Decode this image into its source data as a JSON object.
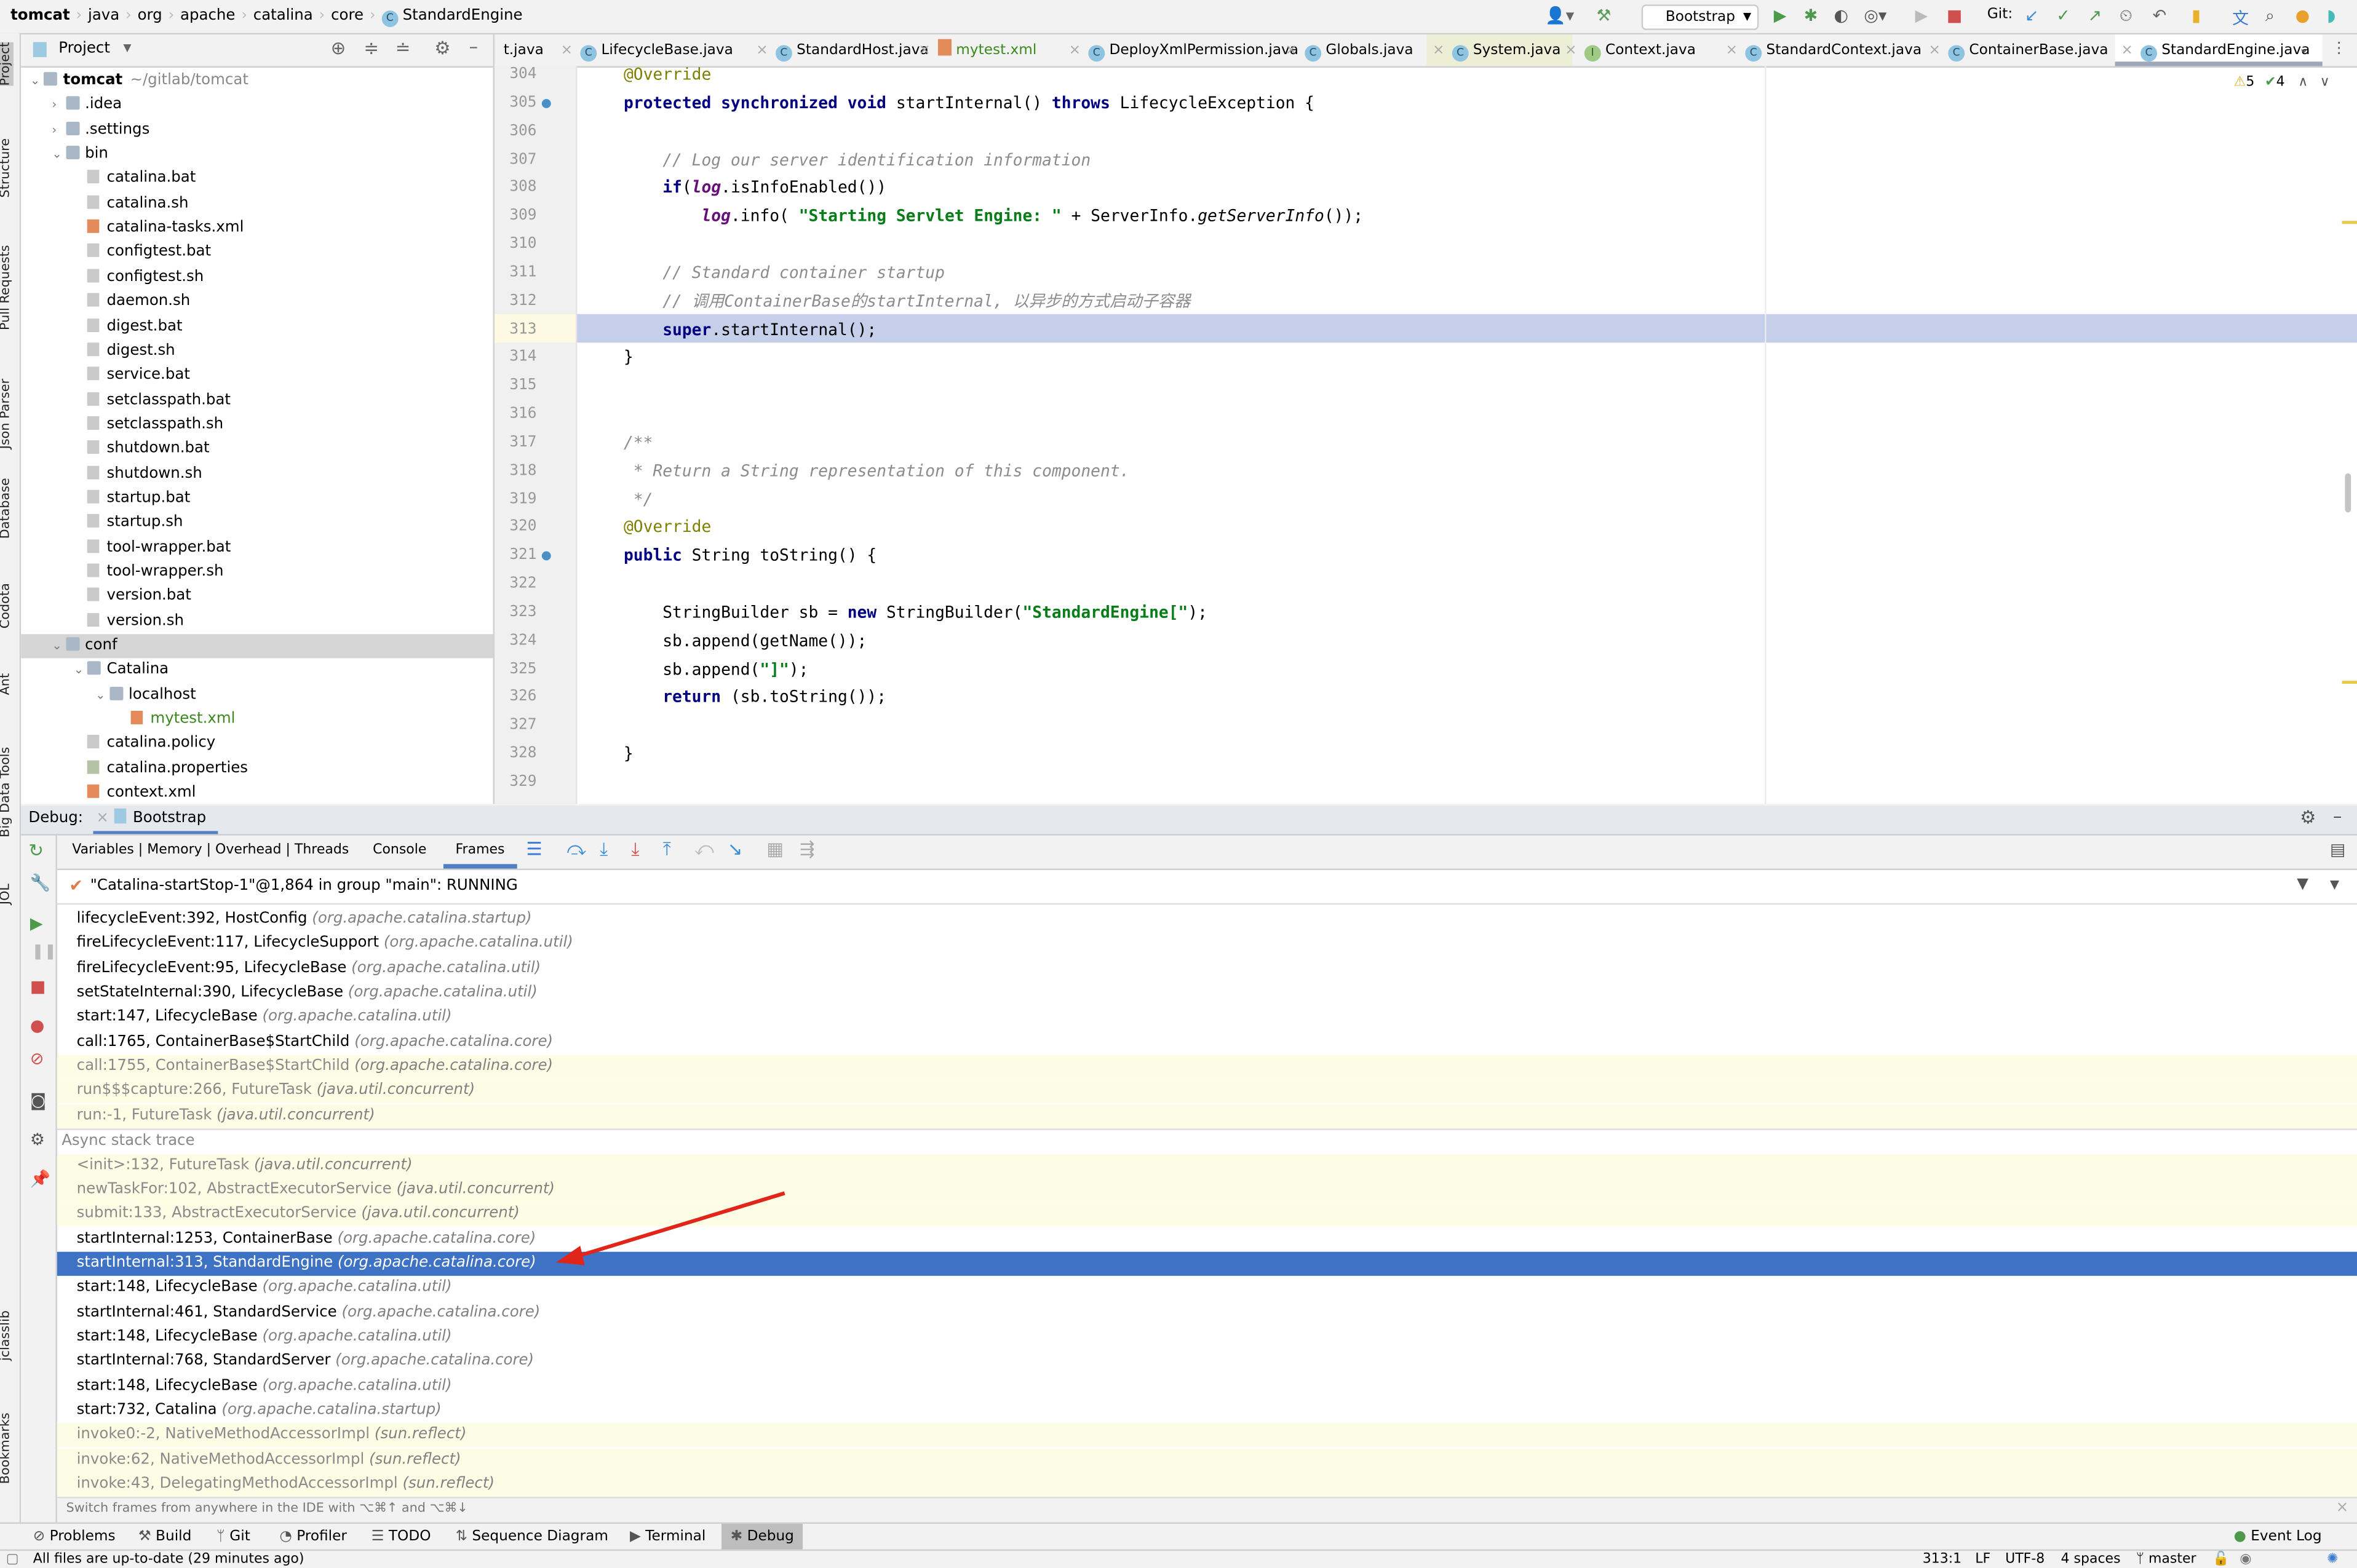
{
  "breadcrumb": [
    "tomcat",
    "java",
    "org",
    "apache",
    "catalina",
    "core",
    "StandardEngine"
  ],
  "toolbar": {
    "run_config": "Bootstrap",
    "git_label": "Git:"
  },
  "left_stripe": [
    "Project",
    "Structure",
    "Pull Requests",
    "Json Parser",
    "Database",
    "Codota",
    "Ant",
    "Big Data Tools",
    "JOL",
    "jclasslib",
    "Bookmarks"
  ],
  "project": {
    "title": "Project",
    "tree": [
      {
        "label": "tomcat",
        "suffix": "~/gitlab/tomcat",
        "depth": 0,
        "type": "folder",
        "open": true,
        "bold": true
      },
      {
        "label": ".idea",
        "depth": 1,
        "type": "folder",
        "open": false
      },
      {
        "label": ".settings",
        "depth": 1,
        "type": "folder",
        "open": false
      },
      {
        "label": "bin",
        "depth": 1,
        "type": "folder",
        "open": true
      },
      {
        "label": "catalina.bat",
        "depth": 2,
        "type": "file"
      },
      {
        "label": "catalina.sh",
        "depth": 2,
        "type": "file"
      },
      {
        "label": "catalina-tasks.xml",
        "depth": 2,
        "type": "xml"
      },
      {
        "label": "configtest.bat",
        "depth": 2,
        "type": "file"
      },
      {
        "label": "configtest.sh",
        "depth": 2,
        "type": "file"
      },
      {
        "label": "daemon.sh",
        "depth": 2,
        "type": "file"
      },
      {
        "label": "digest.bat",
        "depth": 2,
        "type": "file"
      },
      {
        "label": "digest.sh",
        "depth": 2,
        "type": "file"
      },
      {
        "label": "service.bat",
        "depth": 2,
        "type": "file"
      },
      {
        "label": "setclasspath.bat",
        "depth": 2,
        "type": "file"
      },
      {
        "label": "setclasspath.sh",
        "depth": 2,
        "type": "file"
      },
      {
        "label": "shutdown.bat",
        "depth": 2,
        "type": "file"
      },
      {
        "label": "shutdown.sh",
        "depth": 2,
        "type": "file"
      },
      {
        "label": "startup.bat",
        "depth": 2,
        "type": "file"
      },
      {
        "label": "startup.sh",
        "depth": 2,
        "type": "file"
      },
      {
        "label": "tool-wrapper.bat",
        "depth": 2,
        "type": "file"
      },
      {
        "label": "tool-wrapper.sh",
        "depth": 2,
        "type": "file"
      },
      {
        "label": "version.bat",
        "depth": 2,
        "type": "file"
      },
      {
        "label": "version.sh",
        "depth": 2,
        "type": "file"
      },
      {
        "label": "conf",
        "depth": 1,
        "type": "folder",
        "open": true,
        "selected": true
      },
      {
        "label": "Catalina",
        "depth": 2,
        "type": "folder",
        "open": true
      },
      {
        "label": "localhost",
        "depth": 3,
        "type": "folder",
        "open": true
      },
      {
        "label": "mytest.xml",
        "depth": 4,
        "type": "xml",
        "green": true
      },
      {
        "label": "catalina.policy",
        "depth": 2,
        "type": "file"
      },
      {
        "label": "catalina.properties",
        "depth": 2,
        "type": "prop"
      },
      {
        "label": "context.xml",
        "depth": 2,
        "type": "xml"
      }
    ]
  },
  "tabs": [
    {
      "label": "t.java",
      "icon": "none"
    },
    {
      "label": "LifecycleBase.java",
      "icon": "c"
    },
    {
      "label": "StandardHost.java",
      "icon": "c"
    },
    {
      "label": "mytest.xml",
      "icon": "xml",
      "green": true
    },
    {
      "label": "DeployXmlPermission.java",
      "icon": "c"
    },
    {
      "label": "Globals.java",
      "icon": "c"
    },
    {
      "label": "System.java",
      "icon": "c",
      "pinned": true
    },
    {
      "label": "Context.java",
      "icon": "i"
    },
    {
      "label": "StandardContext.java",
      "icon": "c"
    },
    {
      "label": "ContainerBase.java",
      "icon": "c"
    },
    {
      "label": "StandardEngine.java",
      "icon": "c",
      "selected": true
    }
  ],
  "inspections": {
    "warnings": "5",
    "ok": "4"
  },
  "code": [
    {
      "n": "304",
      "toks": [
        [
          "    ",
          ""
        ],
        [
          "@Override",
          "ann"
        ]
      ]
    },
    {
      "n": "305",
      "toks": [
        [
          "    ",
          ""
        ],
        [
          "protected synchronized void ",
          "kw"
        ],
        [
          "startInternal() ",
          ""
        ],
        [
          "throws ",
          "kw"
        ],
        [
          "LifecycleException {",
          ""
        ]
      ]
    },
    {
      "n": "306",
      "toks": []
    },
    {
      "n": "307",
      "toks": [
        [
          "        ",
          ""
        ],
        [
          "// Log our server identification information",
          "cmt"
        ]
      ]
    },
    {
      "n": "308",
      "toks": [
        [
          "        ",
          ""
        ],
        [
          "if",
          "kw"
        ],
        [
          "(",
          ""
        ],
        [
          "log",
          "fld"
        ],
        [
          ".isInfoEnabled())",
          ""
        ]
      ]
    },
    {
      "n": "309",
      "toks": [
        [
          "            ",
          ""
        ],
        [
          "log",
          "fld"
        ],
        [
          ".info( ",
          ""
        ],
        [
          "\"Starting Servlet Engine: \"",
          "str"
        ],
        [
          " + ServerInfo.",
          ""
        ],
        [
          "getServerInfo",
          "ital"
        ],
        [
          "());",
          ""
        ]
      ]
    },
    {
      "n": "310",
      "toks": []
    },
    {
      "n": "311",
      "toks": [
        [
          "        ",
          ""
        ],
        [
          "// Standard container startup",
          "cmt"
        ]
      ]
    },
    {
      "n": "312",
      "toks": [
        [
          "        ",
          ""
        ],
        [
          "// 调用ContainerBase的startInternal, 以异步的方式启动子容器",
          "cmt"
        ]
      ]
    },
    {
      "n": "313",
      "toks": [
        [
          "        ",
          ""
        ],
        [
          "super",
          "kw"
        ],
        [
          ".startInternal();",
          ""
        ]
      ]
    },
    {
      "n": "314",
      "toks": [
        [
          "    }",
          ""
        ]
      ]
    },
    {
      "n": "315",
      "toks": []
    },
    {
      "n": "316",
      "toks": []
    },
    {
      "n": "317",
      "toks": [
        [
          "    ",
          ""
        ],
        [
          "/**",
          "cmt"
        ]
      ]
    },
    {
      "n": "318",
      "toks": [
        [
          "     ",
          ""
        ],
        [
          "* Return a String representation of this component.",
          "cmt"
        ]
      ]
    },
    {
      "n": "319",
      "toks": [
        [
          "     ",
          ""
        ],
        [
          "*/",
          "cmt"
        ]
      ]
    },
    {
      "n": "320",
      "toks": [
        [
          "    ",
          ""
        ],
        [
          "@Override",
          "ann"
        ]
      ]
    },
    {
      "n": "321",
      "toks": [
        [
          "    ",
          ""
        ],
        [
          "public ",
          "kw"
        ],
        [
          "String toString() {",
          ""
        ]
      ]
    },
    {
      "n": "322",
      "toks": []
    },
    {
      "n": "323",
      "toks": [
        [
          "        StringBuilder sb = ",
          ""
        ],
        [
          "new ",
          "kw"
        ],
        [
          "StringBuilder(",
          ""
        ],
        [
          "\"StandardEngine[\"",
          "str"
        ],
        [
          ");",
          ""
        ]
      ]
    },
    {
      "n": "324",
      "toks": [
        [
          "        sb.append(getName());",
          ""
        ]
      ]
    },
    {
      "n": "325",
      "toks": [
        [
          "        sb.append(",
          ""
        ],
        [
          "\"]\"",
          "str"
        ],
        [
          ");",
          ""
        ]
      ]
    },
    {
      "n": "326",
      "toks": [
        [
          "        ",
          ""
        ],
        [
          "return ",
          "kw"
        ],
        [
          "(sb.toString());",
          ""
        ]
      ]
    },
    {
      "n": "327",
      "toks": []
    },
    {
      "n": "328",
      "toks": [
        [
          "    }",
          ""
        ]
      ]
    },
    {
      "n": "329",
      "toks": []
    }
  ],
  "debug": {
    "label": "Debug:",
    "session": "Bootstrap",
    "tabs": [
      "Variables | Memory | Overhead | Threads",
      "Console",
      "Frames"
    ],
    "active_tab": "Frames",
    "thread": "\"Catalina-startStop-1\"@1,864 in group \"main\": RUNNING",
    "async_label": "Async stack trace",
    "frames": [
      {
        "m": "lifecycleEvent:392, HostConfig",
        "p": "(org.apache.catalina.startup)"
      },
      {
        "m": "fireLifecycleEvent:117, LifecycleSupport",
        "p": "(org.apache.catalina.util)"
      },
      {
        "m": "fireLifecycleEvent:95, LifecycleBase",
        "p": "(org.apache.catalina.util)"
      },
      {
        "m": "setStateInternal:390, LifecycleBase",
        "p": "(org.apache.catalina.util)"
      },
      {
        "m": "start:147, LifecycleBase",
        "p": "(org.apache.catalina.util)"
      },
      {
        "m": "call:1765, ContainerBase$StartChild",
        "p": "(org.apache.catalina.core)"
      },
      {
        "m": "call:1755, ContainerBase$StartChild",
        "p": "(org.apache.catalina.core)",
        "lib": true
      },
      {
        "m": "run$$$capture:266, FutureTask",
        "p": "(java.util.concurrent)",
        "lib": true
      },
      {
        "m": "run:-1, FutureTask",
        "p": "(java.util.concurrent)",
        "lib": true
      },
      {
        "async": true
      },
      {
        "m": "<init>:132, FutureTask",
        "p": "(java.util.concurrent)",
        "lib": true
      },
      {
        "m": "newTaskFor:102, AbstractExecutorService",
        "p": "(java.util.concurrent)",
        "lib": true
      },
      {
        "m": "submit:133, AbstractExecutorService",
        "p": "(java.util.concurrent)",
        "lib": true
      },
      {
        "m": "startInternal:1253, ContainerBase",
        "p": "(org.apache.catalina.core)"
      },
      {
        "m": "startInternal:313, StandardEngine",
        "p": "(org.apache.catalina.core)",
        "selected": true
      },
      {
        "m": "start:148, LifecycleBase",
        "p": "(org.apache.catalina.util)"
      },
      {
        "m": "startInternal:461, StandardService",
        "p": "(org.apache.catalina.core)"
      },
      {
        "m": "start:148, LifecycleBase",
        "p": "(org.apache.catalina.util)"
      },
      {
        "m": "startInternal:768, StandardServer",
        "p": "(org.apache.catalina.core)"
      },
      {
        "m": "start:148, LifecycleBase",
        "p": "(org.apache.catalina.util)"
      },
      {
        "m": "start:732, Catalina",
        "p": "(org.apache.catalina.startup)"
      },
      {
        "m": "invoke0:-2, NativeMethodAccessorImpl",
        "p": "(sun.reflect)",
        "lib": true
      },
      {
        "m": "invoke:62, NativeMethodAccessorImpl",
        "p": "(sun.reflect)",
        "lib": true
      },
      {
        "m": "invoke:43, DelegatingMethodAccessorImpl",
        "p": "(sun.reflect)",
        "lib": true
      }
    ],
    "hint": "Switch frames from anywhere in the IDE with ⌥⌘↑ and ⌥⌘↓"
  },
  "bottom_tabs": [
    "Problems",
    "Build",
    "Git",
    "Profiler",
    "TODO",
    "Sequence Diagram",
    "Terminal",
    "Debug"
  ],
  "active_bottom_tab": "Debug",
  "event_log": "Event Log",
  "status": {
    "message": "All files are up-to-date (29 minutes ago)",
    "position": "313:1",
    "line_sep": "LF",
    "encoding": "UTF-8",
    "indent": "4 spaces",
    "branch": "master"
  },
  "colors": {
    "selection": "#3d72c4",
    "current_line": "#c5cfea",
    "arrow": "#e0261b",
    "library_frame": "#fdfde6"
  }
}
